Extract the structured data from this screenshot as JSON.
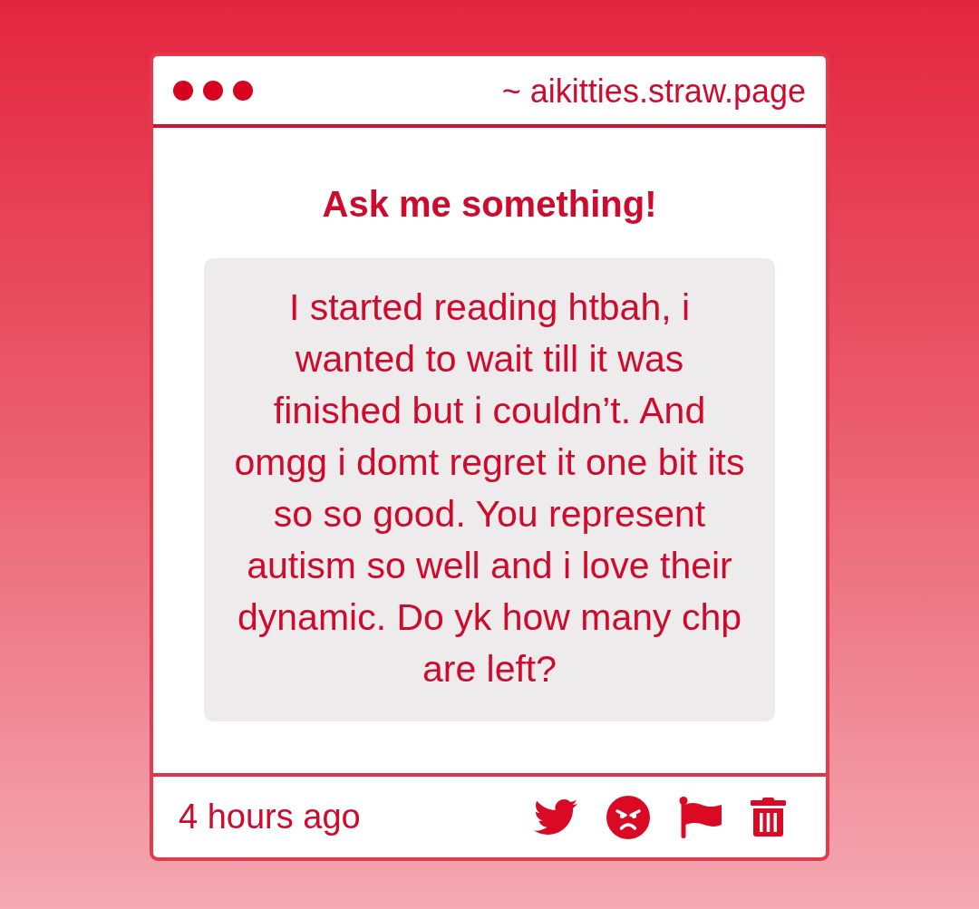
{
  "window": {
    "address": "~ aikitties.straw.page"
  },
  "prompt": {
    "title": "Ask me something!"
  },
  "question": {
    "text": "I started reading htbah, i wanted to wait till it was finished but i couldn’t. And omgg i domt regret it one bit its so so good. You represent autism so well and i love their dynamic. Do yk how many chp are left?"
  },
  "footer": {
    "time": "4 hours ago",
    "actions": [
      {
        "kind": "bird"
      },
      {
        "kind": "angry-face"
      },
      {
        "kind": "flag"
      },
      {
        "kind": "trash"
      }
    ]
  }
}
